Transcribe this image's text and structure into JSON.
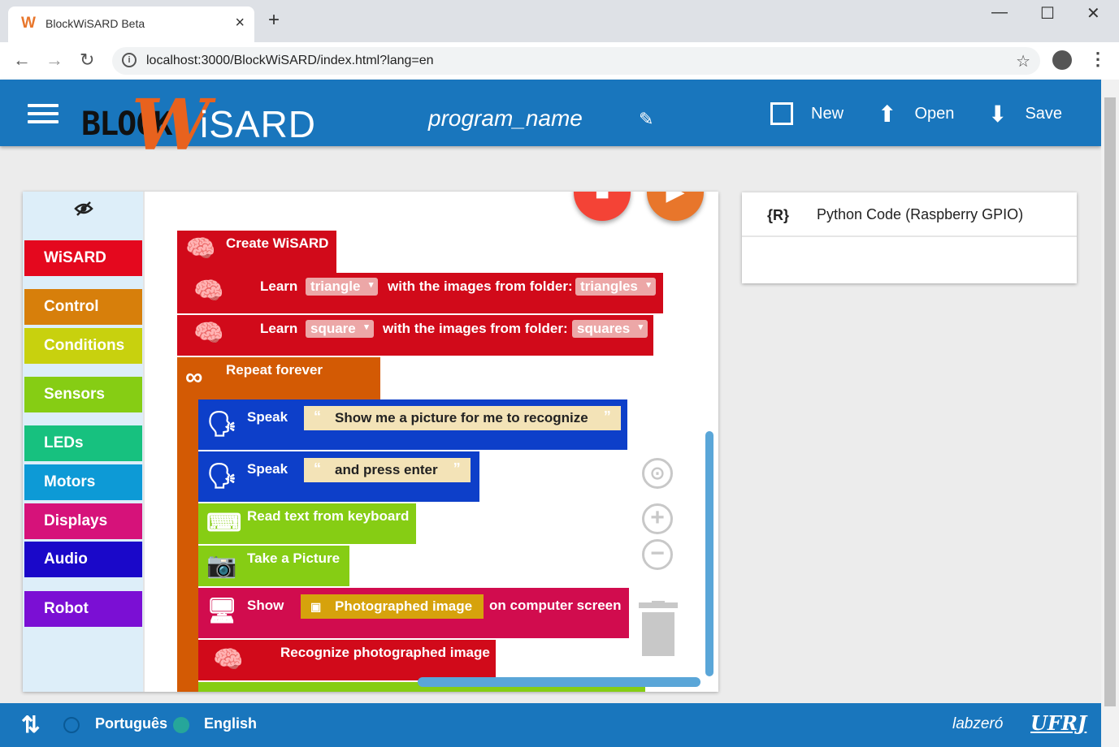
{
  "browser": {
    "tab_title": "BlockWiSARD Beta",
    "tab_favicon": "W",
    "url": "localhost:3000/BlockWiSARD/index.html?lang=en"
  },
  "header": {
    "logo_block": "BLOCK",
    "logo_w": "W",
    "logo_isard": "iSARD",
    "program_name": "program_name",
    "new_label": "New",
    "open_label": "Open",
    "save_label": "Save"
  },
  "toolbox": {
    "categories": [
      {
        "label": "WiSARD",
        "color": "#e4081e"
      },
      {
        "label": "Control",
        "color": "#d77f0b"
      },
      {
        "label": "Conditions",
        "color": "#c8d10e"
      },
      {
        "label": "Sensors",
        "color": "#86cd14"
      },
      {
        "label": "LEDs",
        "color": "#17c17f"
      },
      {
        "label": "Motors",
        "color": "#0d9ad6"
      },
      {
        "label": "Displays",
        "color": "#d6127a"
      },
      {
        "label": "Audio",
        "color": "#1a08c9"
      },
      {
        "label": "Robot",
        "color": "#7b0fd4"
      }
    ]
  },
  "blocks": {
    "create": "Create WiSARD",
    "learn1": {
      "learn": "Learn",
      "class": "triangle",
      "mid": "with the images from folder:",
      "folder": "triangles"
    },
    "learn2": {
      "learn": "Learn",
      "class": "square",
      "mid": "with the images from folder:",
      "folder": "squares"
    },
    "repeat": "Repeat forever",
    "speak1": {
      "label": "Speak",
      "text": "Show me a picture for me to recognize"
    },
    "speak2": {
      "label": "Speak",
      "text": "and press enter"
    },
    "read_keyboard": "Read text from keyboard",
    "take_picture": "Take a Picture",
    "show": {
      "label": "Show",
      "value": "Photographed image",
      "suffix": "on computer screen"
    },
    "recognize": "Recognize photographed image"
  },
  "code_panel": {
    "icon": "{R}",
    "title": "Python Code (Raspberry GPIO)"
  },
  "footer": {
    "lang_pt": "Português",
    "lang_en": "English",
    "logo1": "labzeró",
    "logo2": "UFRJ"
  },
  "colors": {
    "header_blue": "#1976bd",
    "wisard_red": "#d10a1a",
    "control_orange": "#d35a04",
    "speak_blue": "#0d3fc9",
    "sensor_green": "#86cd14",
    "display_pink": "#d10c4e",
    "stop_red": "#f44336",
    "play_orange": "#e8762b"
  }
}
